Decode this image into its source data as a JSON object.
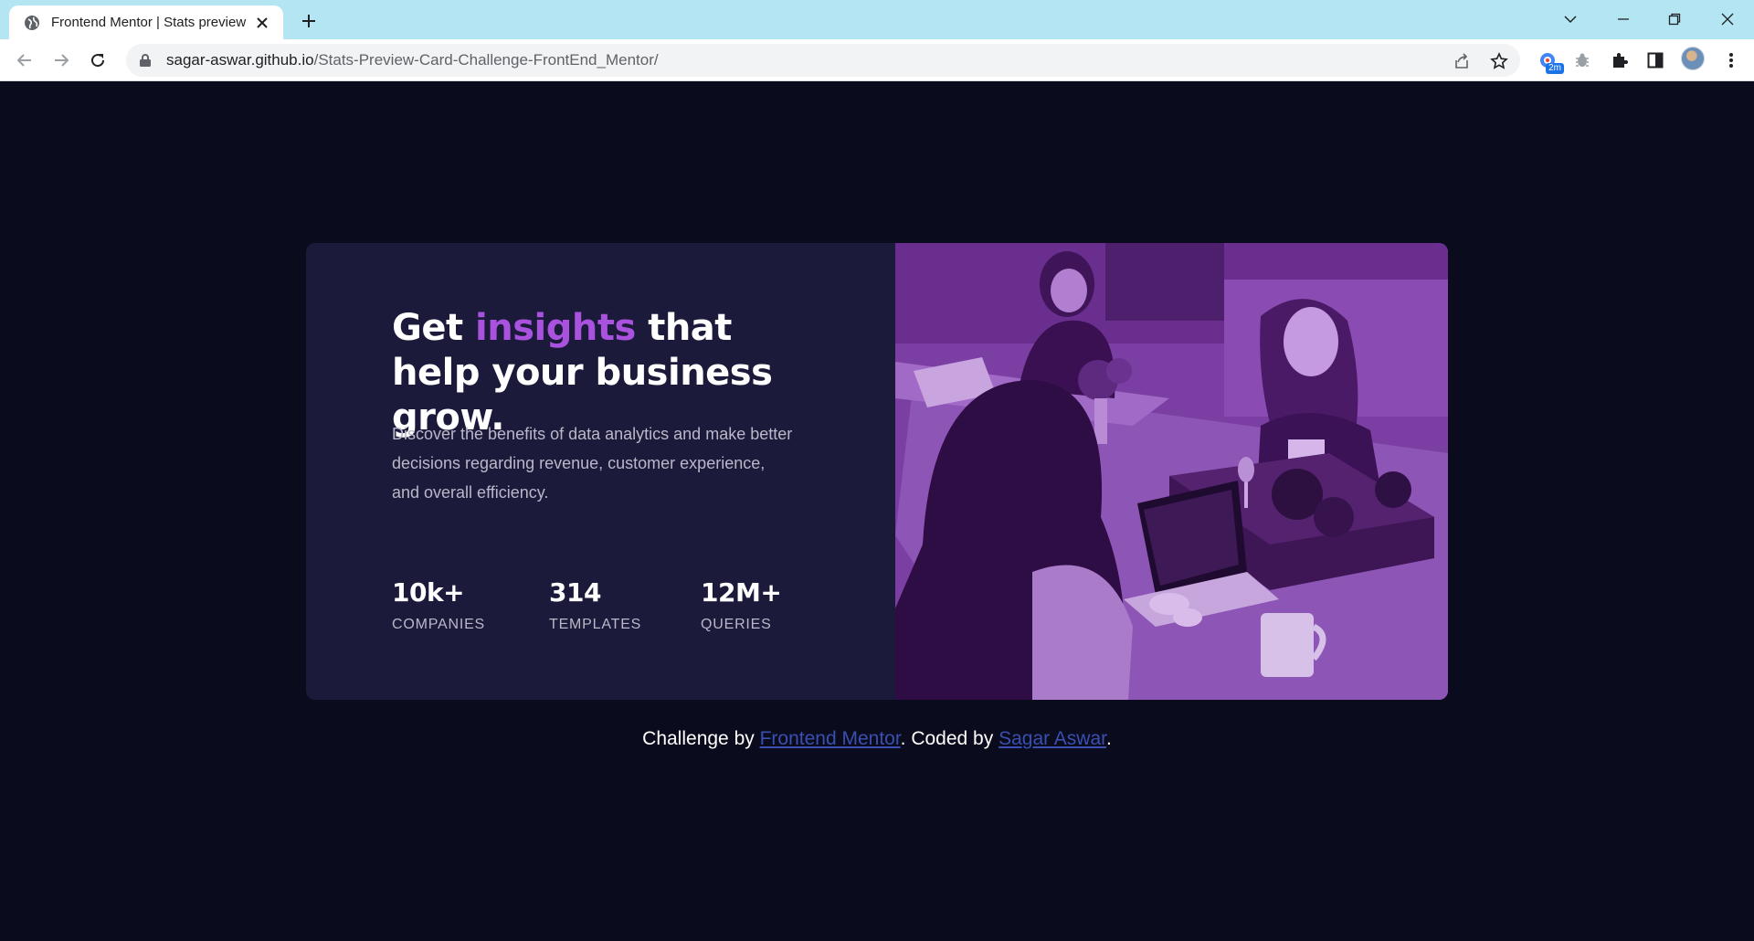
{
  "browser": {
    "tab_title": "Frontend Mentor | Stats preview",
    "url_host": "sagar-aswar.github.io",
    "url_path": "/Stats-Preview-Card-Challenge-FrontEnd_Mentor/",
    "extension_badge": "2m"
  },
  "card": {
    "headline_before": "Get ",
    "headline_accent": "insights",
    "headline_after": " that help your business grow.",
    "description": "Discover the benefits of data analytics and make better decisions regarding revenue, customer experience, and overall efficiency.",
    "stats": [
      {
        "value": "10k+",
        "label": "COMPANIES"
      },
      {
        "value": "314",
        "label": "TEMPLATES"
      },
      {
        "value": "12M+",
        "label": "QUERIES"
      }
    ],
    "accent_color": "#a952de",
    "image_tint": "#7a3ea0"
  },
  "footer": {
    "prefix": "Challenge by ",
    "link1": "Frontend Mentor",
    "middle": ". Coded by ",
    "link2": "Sagar Aswar",
    "suffix": "."
  }
}
